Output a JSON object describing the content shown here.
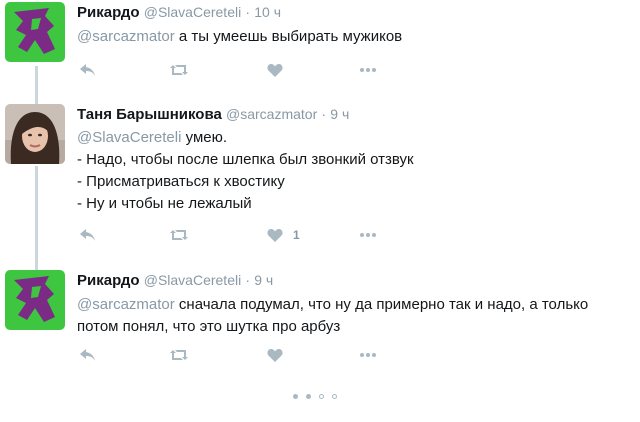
{
  "tweets": [
    {
      "name": "Рикардо",
      "handle": "@SlavaCereteli",
      "separator": "·",
      "time": "10 ч",
      "reply_to": "@sarcazmator",
      "lines": [
        "а ты умеешь выбирать мужиков"
      ],
      "like_count": "",
      "avatar_icon": "ricardo-logo"
    },
    {
      "name": "Таня Барышникова",
      "handle": "@sarcazmator",
      "separator": "·",
      "time": "9 ч",
      "reply_to": "@SlavaCereteli",
      "lines": [
        "умею.",
        "- Надо, чтобы после шлепка был звонкий отзвук",
        "- Присматриваться к хвостику",
        "- Ну и чтобы не лежалый"
      ],
      "like_count": "1",
      "avatar_icon": "woman-photo"
    },
    {
      "name": "Рикардо",
      "handle": "@SlavaCereteli",
      "separator": "·",
      "time": "9 ч",
      "reply_to": "@sarcazmator",
      "lines": [
        "сначала подумал, что ну да примерно так и надо, а только",
        "потом понял, что это шутка про арбуз"
      ],
      "like_count": "",
      "avatar_icon": "ricardo-logo"
    }
  ],
  "colors": {
    "avatar_green": "#3ec640",
    "avatar_purple": "#7b2a86",
    "muted": "#8899a6",
    "thread_line": "#ccd6dd"
  },
  "pager": {
    "dots": 4,
    "active": 2
  }
}
